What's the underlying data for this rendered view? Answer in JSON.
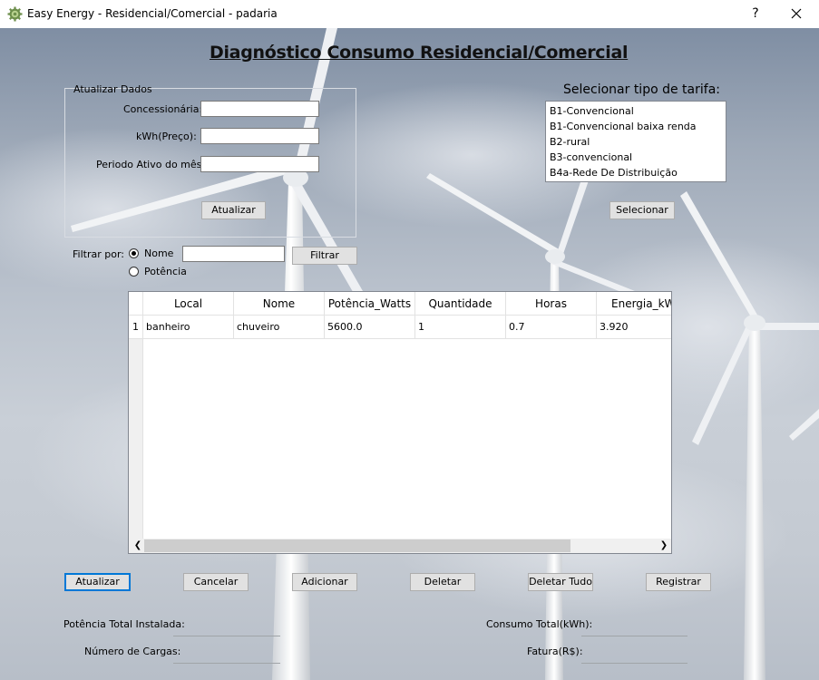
{
  "window": {
    "title": "Easy Energy - Residencial/Comercial - padaria",
    "help_label": "?",
    "close_label": "✕"
  },
  "heading": "Diagnóstico Consumo Residencial/Comercial",
  "update_group": {
    "title": "Atualizar Dados",
    "concessionaria_label": "Concessionária:",
    "concessionaria_value": "",
    "kwh_label": "kWh(Preço):",
    "kwh_value": "",
    "periodo_label": "Periodo Ativo do mês:",
    "periodo_value": "",
    "atualizar_button": "Atualizar"
  },
  "tarifa": {
    "label": "Selecionar tipo de tarifa:",
    "options": [
      "B1-Convencional",
      "B1-Convencional baixa renda",
      "B2-rural",
      "B3-convencional",
      "B4a-Rede De Distribuição"
    ],
    "select_button": "Selecionar"
  },
  "filter": {
    "label": "Filtrar por:",
    "option_nome": "Nome",
    "option_potencia": "Potência",
    "selected": "Nome",
    "input_value": "",
    "button": "Filtrar"
  },
  "table": {
    "columns": [
      "Local",
      "Nome",
      "Potência_Watts",
      "Quantidade",
      "Horas",
      "Energia_kWh"
    ],
    "rows": [
      {
        "index": "1",
        "cells": [
          "banheiro",
          "chuveiro",
          "5600.0",
          "1",
          "0.7",
          "3.920"
        ]
      }
    ]
  },
  "actions": {
    "atualizar": "Atualizar",
    "cancelar": "Cancelar",
    "adicionar": "Adicionar",
    "deletar": "Deletar",
    "deletar_tudo": "Deletar Tudo",
    "registrar": "Registrar"
  },
  "totals": {
    "potencia_label": "Potência Total Instalada:",
    "potencia_value": "",
    "cargas_label": "Número de Cargas:",
    "cargas_value": "",
    "consumo_label": "Consumo Total(kWh):",
    "consumo_value": "",
    "fatura_label": "Fatura(R$):",
    "fatura_value": ""
  }
}
